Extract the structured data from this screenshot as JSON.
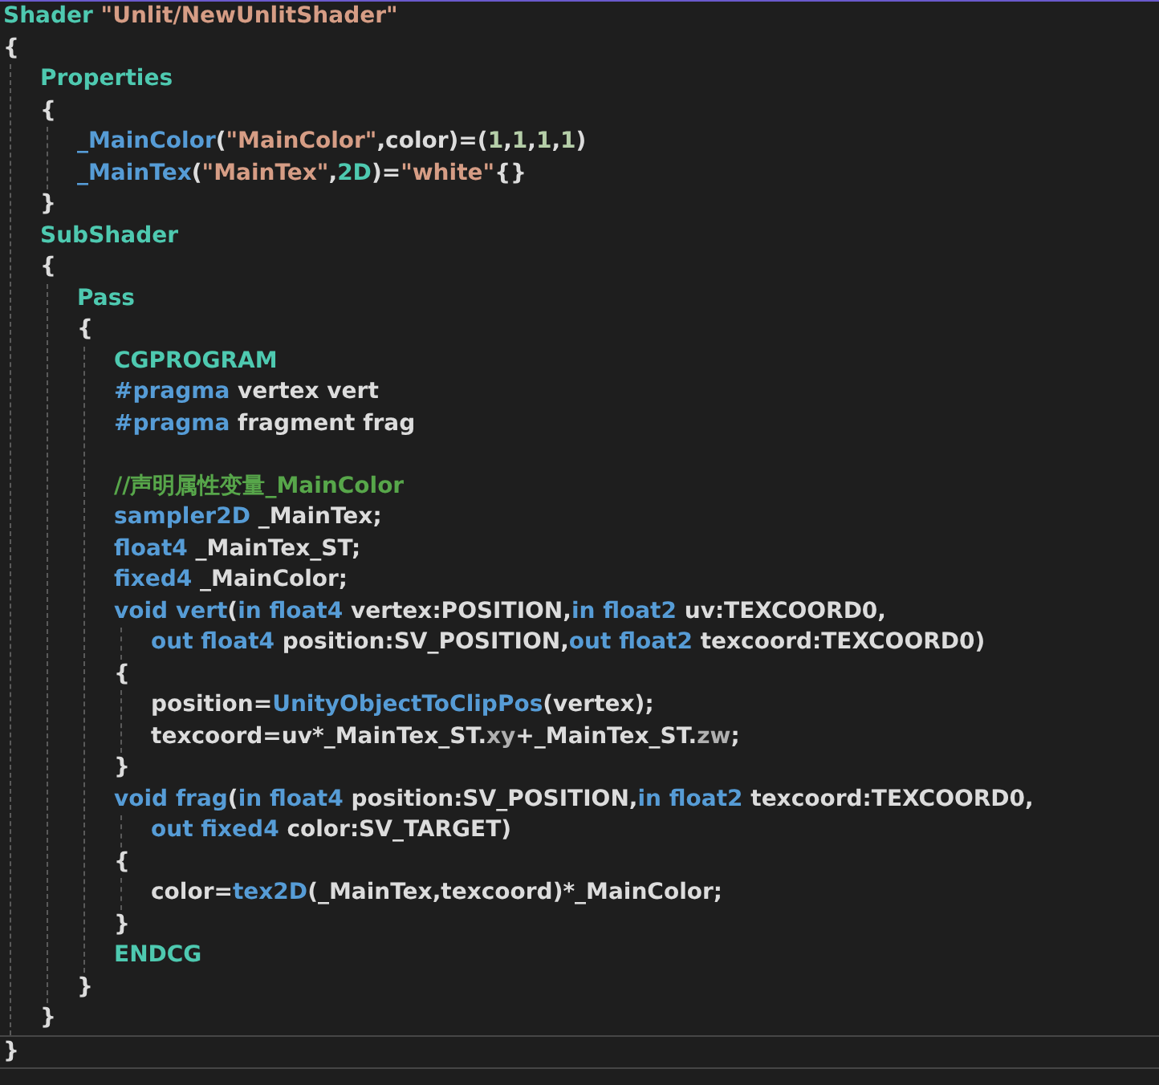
{
  "editor": {
    "lines": [
      {
        "kind": "code",
        "current": false,
        "tokens": [
          {
            "kind": "keyword",
            "text": "Shader "
          },
          {
            "kind": "string",
            "text": "\"Unlit/NewUnlitShader\""
          }
        ]
      },
      {
        "kind": "code",
        "current": false,
        "tokens": [
          {
            "kind": "plain",
            "text": "{"
          }
        ],
        "children": [
          {
            "kind": "code",
            "current": false,
            "tokens": [
              {
                "kind": "keyword",
                "text": "Properties"
              }
            ]
          },
          {
            "kind": "code",
            "current": false,
            "tokens": [
              {
                "kind": "plain",
                "text": "{"
              }
            ],
            "children": [
              {
                "kind": "code",
                "current": false,
                "tokens": [
                  {
                    "kind": "property",
                    "text": "_MainColor"
                  },
                  {
                    "kind": "plain",
                    "text": "("
                  },
                  {
                    "kind": "string",
                    "text": "\"MainColor\""
                  },
                  {
                    "kind": "plain",
                    "text": ",color)=("
                  },
                  {
                    "kind": "number",
                    "text": "1"
                  },
                  {
                    "kind": "plain",
                    "text": ","
                  },
                  {
                    "kind": "number",
                    "text": "1"
                  },
                  {
                    "kind": "plain",
                    "text": ","
                  },
                  {
                    "kind": "number",
                    "text": "1"
                  },
                  {
                    "kind": "plain",
                    "text": ","
                  },
                  {
                    "kind": "number",
                    "text": "1"
                  },
                  {
                    "kind": "plain",
                    "text": ")"
                  }
                ]
              },
              {
                "kind": "code",
                "current": false,
                "tokens": [
                  {
                    "kind": "property",
                    "text": "_MainTex"
                  },
                  {
                    "kind": "plain",
                    "text": "("
                  },
                  {
                    "kind": "string",
                    "text": "\"MainTex\""
                  },
                  {
                    "kind": "plain",
                    "text": ","
                  },
                  {
                    "kind": "keyword",
                    "text": "2D"
                  },
                  {
                    "kind": "plain",
                    "text": ")="
                  },
                  {
                    "kind": "string",
                    "text": "\"white\""
                  },
                  {
                    "kind": "plain",
                    "text": "{}"
                  }
                ]
              }
            ]
          },
          {
            "kind": "code",
            "current": false,
            "tokens": [
              {
                "kind": "plain",
                "text": "}"
              }
            ]
          },
          {
            "kind": "code",
            "current": false,
            "tokens": [
              {
                "kind": "keyword",
                "text": "SubShader"
              }
            ]
          },
          {
            "kind": "code",
            "current": false,
            "tokens": [
              {
                "kind": "plain",
                "text": "{"
              }
            ],
            "children": [
              {
                "kind": "code",
                "current": false,
                "tokens": [
                  {
                    "kind": "keyword",
                    "text": "Pass"
                  }
                ]
              },
              {
                "kind": "code",
                "current": false,
                "tokens": [
                  {
                    "kind": "plain",
                    "text": "{"
                  }
                ],
                "children": [
                  {
                    "kind": "code",
                    "current": false,
                    "tokens": [
                      {
                        "kind": "keyword",
                        "text": "CGPROGRAM"
                      }
                    ]
                  },
                  {
                    "kind": "code",
                    "current": false,
                    "tokens": [
                      {
                        "kind": "type",
                        "text": "#pragma"
                      },
                      {
                        "kind": "plain",
                        "text": " vertex vert"
                      }
                    ]
                  },
                  {
                    "kind": "code",
                    "current": false,
                    "tokens": [
                      {
                        "kind": "type",
                        "text": "#pragma"
                      },
                      {
                        "kind": "plain",
                        "text": " fragment frag"
                      }
                    ]
                  },
                  {
                    "kind": "blank",
                    "current": false
                  },
                  {
                    "kind": "code",
                    "current": false,
                    "tokens": [
                      {
                        "kind": "comment",
                        "text": "//声明属性变量_MainColor"
                      }
                    ]
                  },
                  {
                    "kind": "code",
                    "current": false,
                    "tokens": [
                      {
                        "kind": "type",
                        "text": "sampler2D"
                      },
                      {
                        "kind": "plain",
                        "text": " _MainTex;"
                      }
                    ]
                  },
                  {
                    "kind": "code",
                    "current": false,
                    "tokens": [
                      {
                        "kind": "type",
                        "text": "float4"
                      },
                      {
                        "kind": "plain",
                        "text": " _MainTex_ST;"
                      }
                    ]
                  },
                  {
                    "kind": "code",
                    "current": false,
                    "tokens": [
                      {
                        "kind": "type",
                        "text": "fixed4"
                      },
                      {
                        "kind": "plain",
                        "text": " _MainColor;"
                      }
                    ]
                  },
                  {
                    "kind": "code",
                    "current": false,
                    "tokens": [
                      {
                        "kind": "type",
                        "text": "void "
                      },
                      {
                        "kind": "function",
                        "text": "vert"
                      },
                      {
                        "kind": "plain",
                        "text": "("
                      },
                      {
                        "kind": "type",
                        "text": "in float4"
                      },
                      {
                        "kind": "plain",
                        "text": " vertex:POSITION,"
                      },
                      {
                        "kind": "type",
                        "text": "in float2"
                      },
                      {
                        "kind": "plain",
                        "text": " uv:TEXCOORD0,"
                      }
                    ],
                    "children": [
                      {
                        "kind": "code",
                        "current": false,
                        "tokens": [
                          {
                            "kind": "type",
                            "text": "out float4"
                          },
                          {
                            "kind": "plain",
                            "text": " position:SV_POSITION,"
                          },
                          {
                            "kind": "type",
                            "text": "out float2"
                          },
                          {
                            "kind": "plain",
                            "text": " texcoord:TEXCOORD0)"
                          }
                        ]
                      }
                    ]
                  },
                  {
                    "kind": "code",
                    "current": false,
                    "tokens": [
                      {
                        "kind": "plain",
                        "text": "{"
                      }
                    ],
                    "children": [
                      {
                        "kind": "code",
                        "current": false,
                        "tokens": [
                          {
                            "kind": "plain",
                            "text": "position="
                          },
                          {
                            "kind": "function",
                            "text": "UnityObjectToClipPos"
                          },
                          {
                            "kind": "plain",
                            "text": "(vertex);"
                          }
                        ]
                      },
                      {
                        "kind": "code",
                        "current": false,
                        "tokens": [
                          {
                            "kind": "plain",
                            "text": "texcoord=uv*_MainTex_ST."
                          },
                          {
                            "kind": "member",
                            "text": "xy"
                          },
                          {
                            "kind": "plain",
                            "text": "+_MainTex_ST."
                          },
                          {
                            "kind": "member",
                            "text": "zw"
                          },
                          {
                            "kind": "plain",
                            "text": ";"
                          }
                        ]
                      }
                    ]
                  },
                  {
                    "kind": "code",
                    "current": false,
                    "tokens": [
                      {
                        "kind": "plain",
                        "text": "}"
                      }
                    ]
                  },
                  {
                    "kind": "code",
                    "current": false,
                    "tokens": [
                      {
                        "kind": "type",
                        "text": "void "
                      },
                      {
                        "kind": "function",
                        "text": "frag"
                      },
                      {
                        "kind": "plain",
                        "text": "("
                      },
                      {
                        "kind": "type",
                        "text": "in float4"
                      },
                      {
                        "kind": "plain",
                        "text": " position:SV_POSITION,"
                      },
                      {
                        "kind": "type",
                        "text": "in float2"
                      },
                      {
                        "kind": "plain",
                        "text": " texcoord:TEXCOORD0,"
                      }
                    ],
                    "children": [
                      {
                        "kind": "code",
                        "current": false,
                        "tokens": [
                          {
                            "kind": "type",
                            "text": "out fixed4"
                          },
                          {
                            "kind": "plain",
                            "text": " color:SV_TARGET)"
                          }
                        ]
                      }
                    ]
                  },
                  {
                    "kind": "code",
                    "current": false,
                    "tokens": [
                      {
                        "kind": "plain",
                        "text": "{"
                      }
                    ],
                    "children": [
                      {
                        "kind": "code",
                        "current": false,
                        "tokens": [
                          {
                            "kind": "plain",
                            "text": "color="
                          },
                          {
                            "kind": "function",
                            "text": "tex2D"
                          },
                          {
                            "kind": "plain",
                            "text": "(_MainTex,texcoord)*_MainColor;"
                          }
                        ]
                      }
                    ]
                  },
                  {
                    "kind": "code",
                    "current": false,
                    "tokens": [
                      {
                        "kind": "plain",
                        "text": "}"
                      }
                    ]
                  },
                  {
                    "kind": "code",
                    "current": false,
                    "tokens": [
                      {
                        "kind": "keyword",
                        "text": "ENDCG"
                      }
                    ]
                  }
                ]
              },
              {
                "kind": "code",
                "current": false,
                "tokens": [
                  {
                    "kind": "plain",
                    "text": "}"
                  }
                ]
              }
            ]
          },
          {
            "kind": "code",
            "current": false,
            "tokens": [
              {
                "kind": "plain",
                "text": "}"
              }
            ]
          }
        ]
      },
      {
        "kind": "code",
        "current": true,
        "tokens": [
          {
            "kind": "plain",
            "text": "}"
          }
        ]
      }
    ]
  }
}
